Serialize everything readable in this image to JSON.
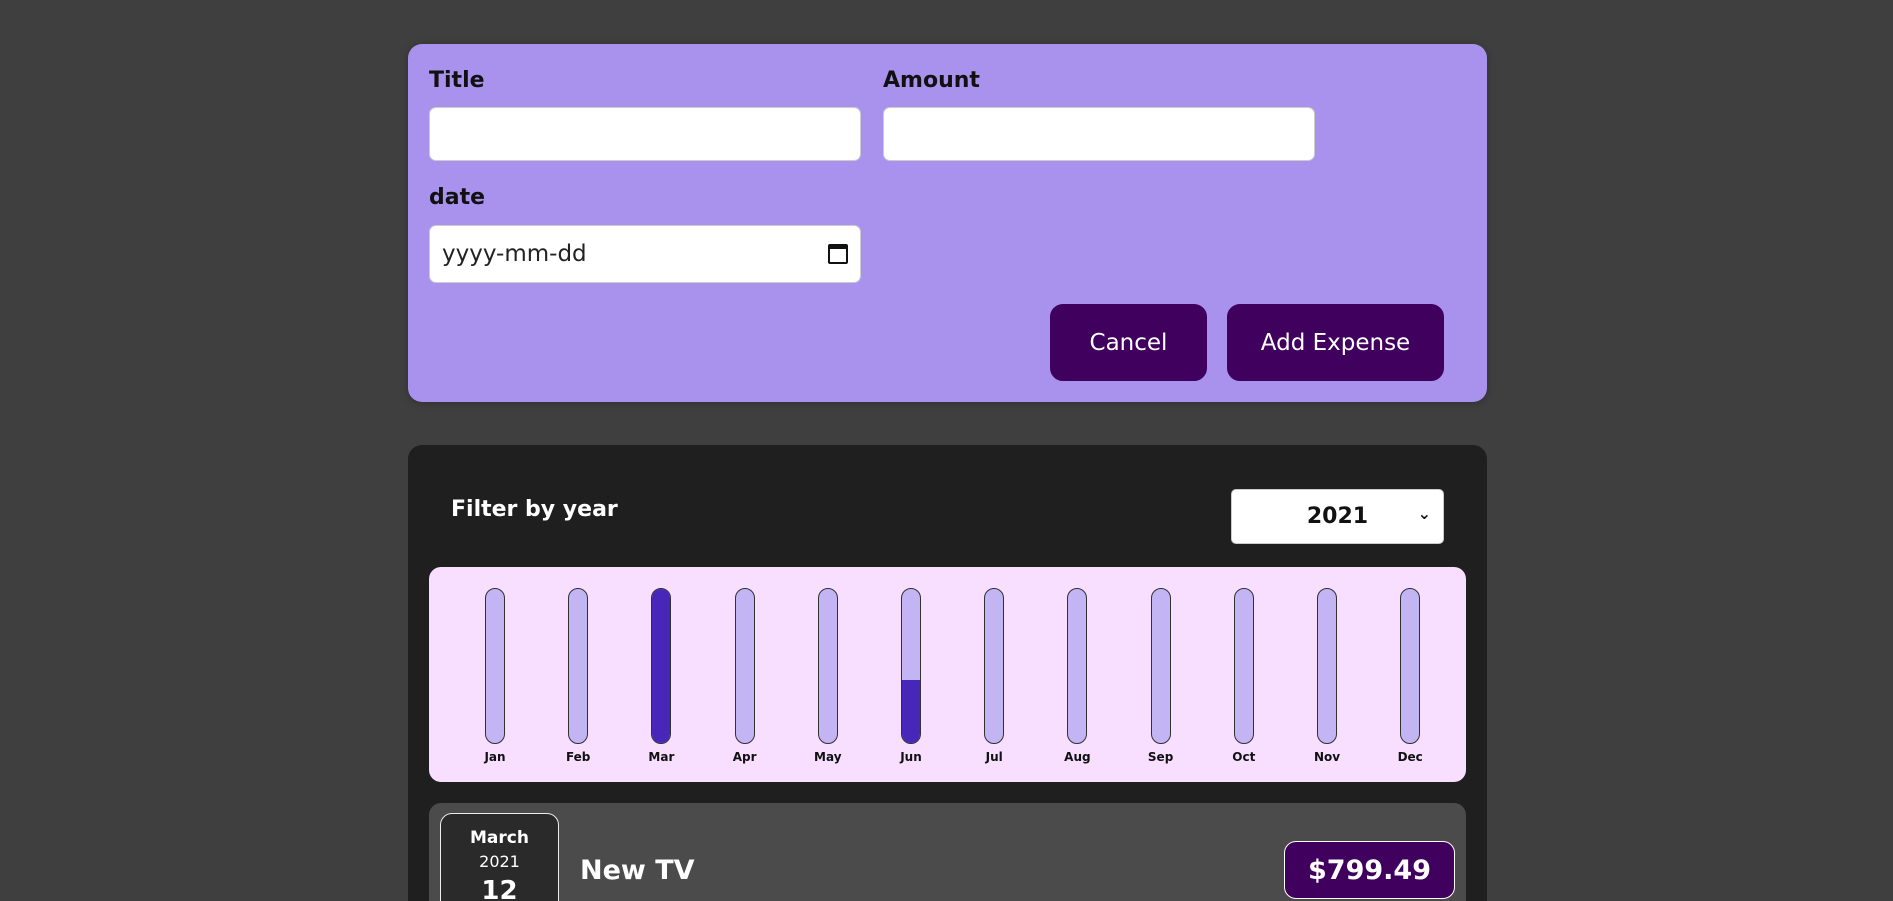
{
  "form": {
    "title_label": "Title",
    "title_value": "",
    "amount_label": "Amount",
    "amount_value": "",
    "date_label": "date",
    "date_placeholder": "yyyy-mm-dd",
    "cancel_label": "Cancel",
    "add_label": "Add Expense"
  },
  "filter": {
    "label": "Filter by year",
    "selected_year": "2021"
  },
  "colors": {
    "form_bg": "#a892ee",
    "button": "#40005d",
    "chart_bg": "#f8dfff",
    "bar_fill": "#4826b9",
    "bar_empty": "#c3b4f3"
  },
  "chart_data": {
    "type": "bar",
    "categories": [
      "Jan",
      "Feb",
      "Mar",
      "Apr",
      "May",
      "Jun",
      "Jul",
      "Aug",
      "Sep",
      "Oct",
      "Nov",
      "Dec"
    ],
    "values": [
      0,
      0,
      1,
      0,
      0,
      0.41,
      0,
      0,
      0,
      0,
      0,
      0
    ]
  },
  "expenses": [
    {
      "month": "March",
      "year": "2021",
      "day": "12",
      "title": "New TV",
      "amount": "$799.49"
    }
  ]
}
